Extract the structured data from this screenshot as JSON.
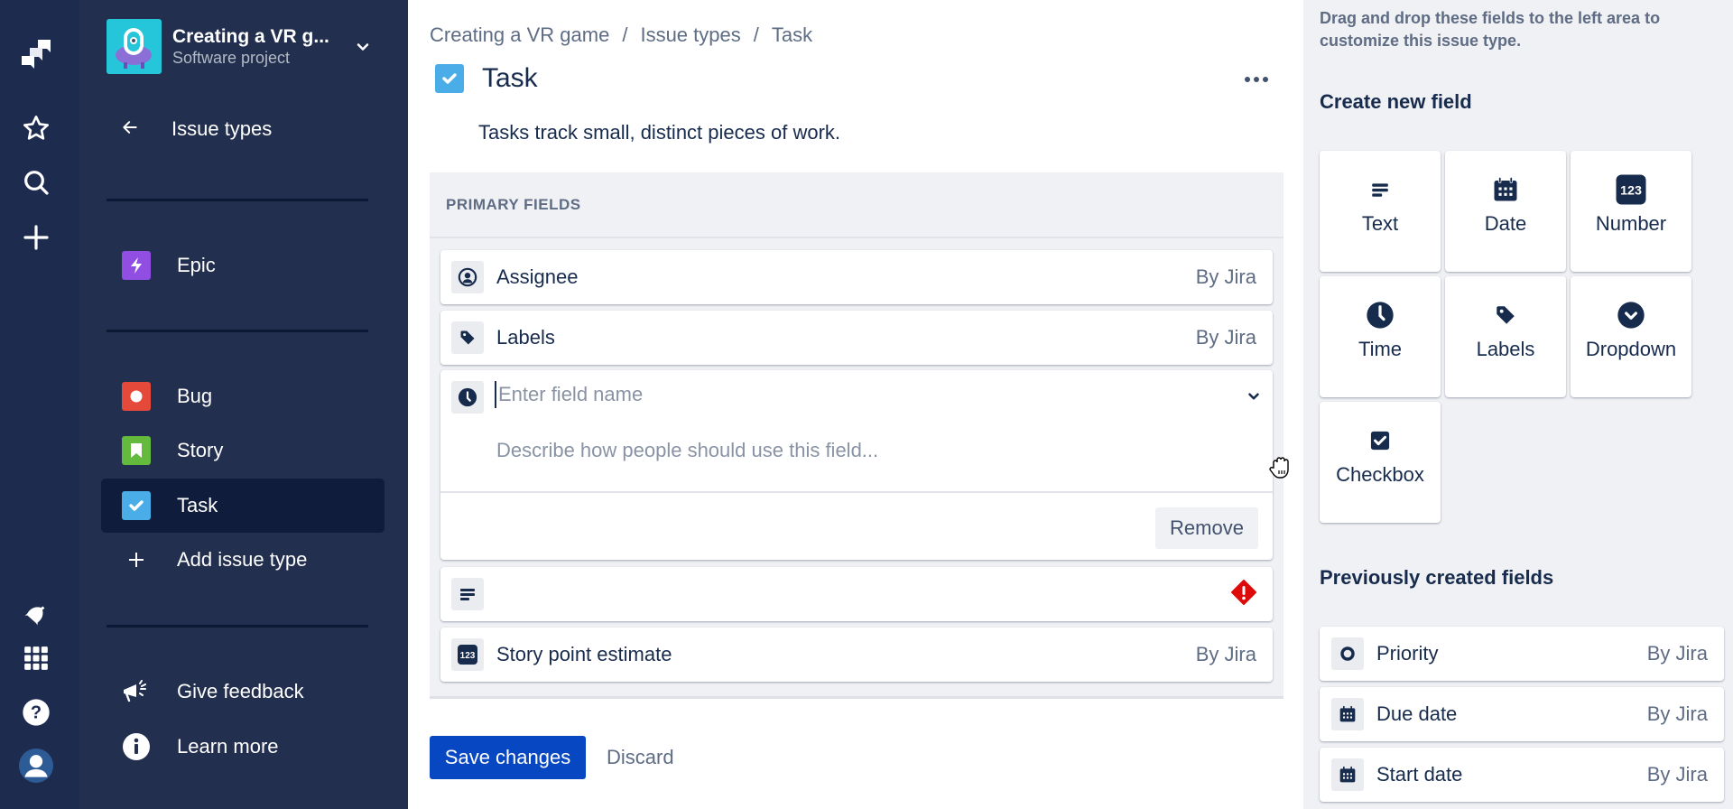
{
  "rail": {
    "icons": [
      "jira-logo-icon",
      "star-icon",
      "search-icon",
      "plus-icon",
      "notification-icon",
      "apps-grid-icon",
      "help-icon",
      "user-avatar-icon"
    ]
  },
  "project": {
    "name": "Creating a VR g...",
    "type": "Software project"
  },
  "sidebar": {
    "back_label": "Issue types",
    "items": [
      {
        "label": "Epic",
        "icon": "epic-icon",
        "color": "#904ee2"
      },
      {
        "label": "Bug",
        "icon": "bug-icon",
        "color": "#e5493a"
      },
      {
        "label": "Story",
        "icon": "story-icon",
        "color": "#63ba3c"
      },
      {
        "label": "Task",
        "icon": "task-icon",
        "color": "#4bade8",
        "active": true
      }
    ],
    "add_label": "Add issue type",
    "feedback_label": "Give feedback",
    "learn_label": "Learn more"
  },
  "breadcrumb": [
    "Creating a VR game",
    "Issue types",
    "Task"
  ],
  "header": {
    "title": "Task",
    "description": "Tasks track small, distinct pieces of work."
  },
  "primary": {
    "heading": "PRIMARY FIELDS",
    "fields": [
      {
        "label": "Assignee",
        "by": "By Jira",
        "icon": "assignee-icon"
      },
      {
        "label": "Labels",
        "by": "By Jira",
        "icon": "label-icon"
      }
    ],
    "editor": {
      "name_placeholder": "Enter field name",
      "desc_placeholder": "Describe how people should use this field...",
      "remove_label": "Remove",
      "icon": "clock-icon"
    },
    "error_field": {
      "label": "",
      "icon": "text-icon",
      "status": "error-icon"
    },
    "last_field": {
      "label": "Story point estimate",
      "by": "By Jira",
      "icon": "number-icon"
    }
  },
  "actions": {
    "save_label": "Save changes",
    "discard_label": "Discard"
  },
  "right": {
    "hint": "Drag and drop these fields to the left area to customize this issue type.",
    "create_title": "Create new field",
    "tiles": [
      {
        "label": "Text",
        "icon": "text-icon"
      },
      {
        "label": "Date",
        "icon": "calendar-icon"
      },
      {
        "label": "Number",
        "icon": "number-icon",
        "glyph": "123"
      },
      {
        "label": "Time",
        "icon": "clock-icon"
      },
      {
        "label": "Labels",
        "icon": "label-icon"
      },
      {
        "label": "Dropdown",
        "icon": "dropdown-icon"
      },
      {
        "label": "Checkbox",
        "icon": "checkbox-icon"
      }
    ],
    "previous_title": "Previously created fields",
    "previous": [
      {
        "label": "Priority",
        "by": "By Jira",
        "icon": "priority-icon"
      },
      {
        "label": "Due date",
        "by": "By Jira",
        "icon": "calendar-icon"
      },
      {
        "label": "Start date",
        "by": "By Jira",
        "icon": "calendar-icon"
      }
    ]
  },
  "colors": {
    "rail_bg": "#1d2b4f",
    "sidebar_bg": "#232f4e",
    "primary_button": "#0747c2",
    "error": "#de350b"
  }
}
